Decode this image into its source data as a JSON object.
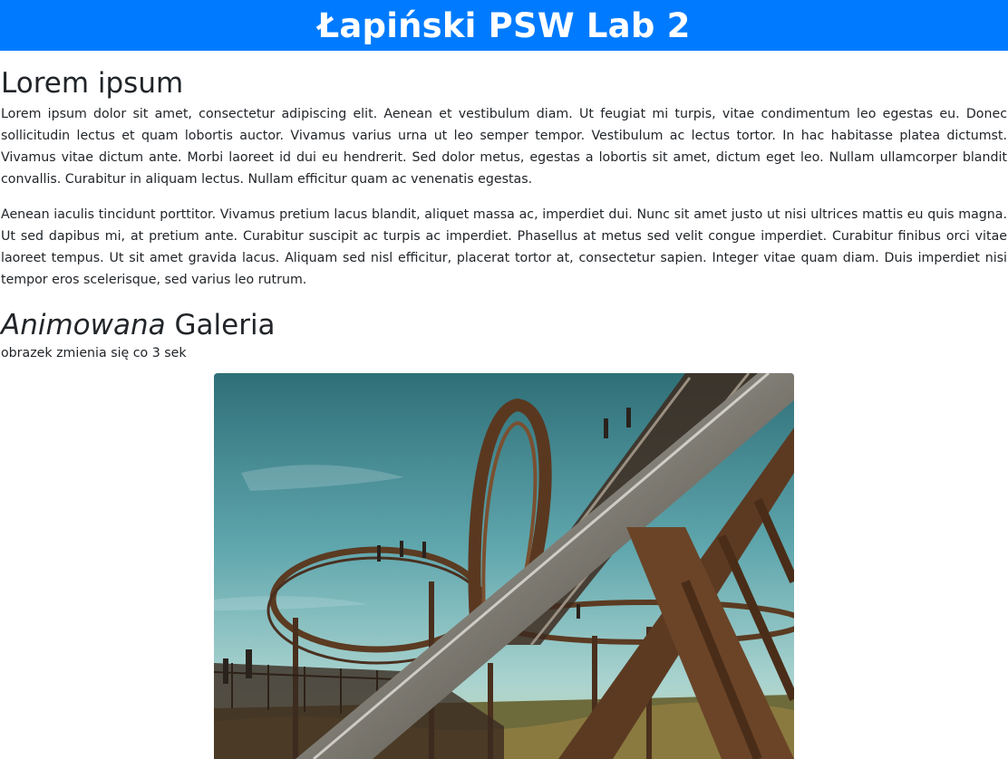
{
  "header": {
    "title": "Łapiński PSW Lab 2",
    "background": "#007bff"
  },
  "main": {
    "lorem_title": "Lorem ipsum",
    "paragraphs": [
      "Lorem ipsum dolor sit amet, consectetur adipiscing elit. Aenean et vestibulum diam. Ut feugiat mi turpis, vitae condimentum leo egestas eu. Donec sollicitudin lectus et quam lobortis auctor. Vivamus varius urna ut leo semper tempor. Vestibulum ac lectus tortor. In hac habitasse platea dictumst. Vivamus vitae dictum ante. Morbi laoreet id dui eu hendrerit. Sed dolor metus, egestas a lobortis sit amet, dictum eget leo. Nullam ullamcorper blandit convallis. Curabitur in aliquam lectus. Nullam efficitur quam ac venenatis egestas.",
      "Aenean iaculis tincidunt porttitor. Vivamus pretium lacus blandit, aliquet massa ac, imperdiet dui. Nunc sit amet justo ut nisi ultrices mattis eu quis magna. Ut sed dapibus mi, at pretium ante. Curabitur suscipit ac turpis ac imperdiet. Phasellus at metus sed velit congue imperdiet. Curabitur finibus orci vitae laoreet tempus. Ut sit amet gravida lacus. Aliquam sed nisl efficitur, placerat tortor at, consectetur sapien. Integer vitae quam diam. Duis imperdiet nisi tempor eros scelerisque, sed varius leo rutrum."
    ]
  },
  "gallery": {
    "title_italic": "Animowana",
    "title_rest": "Galeria",
    "caption": "obrazek zmienia się co 3 sek",
    "image_subject": "roller-coaster-walkway-photo"
  }
}
